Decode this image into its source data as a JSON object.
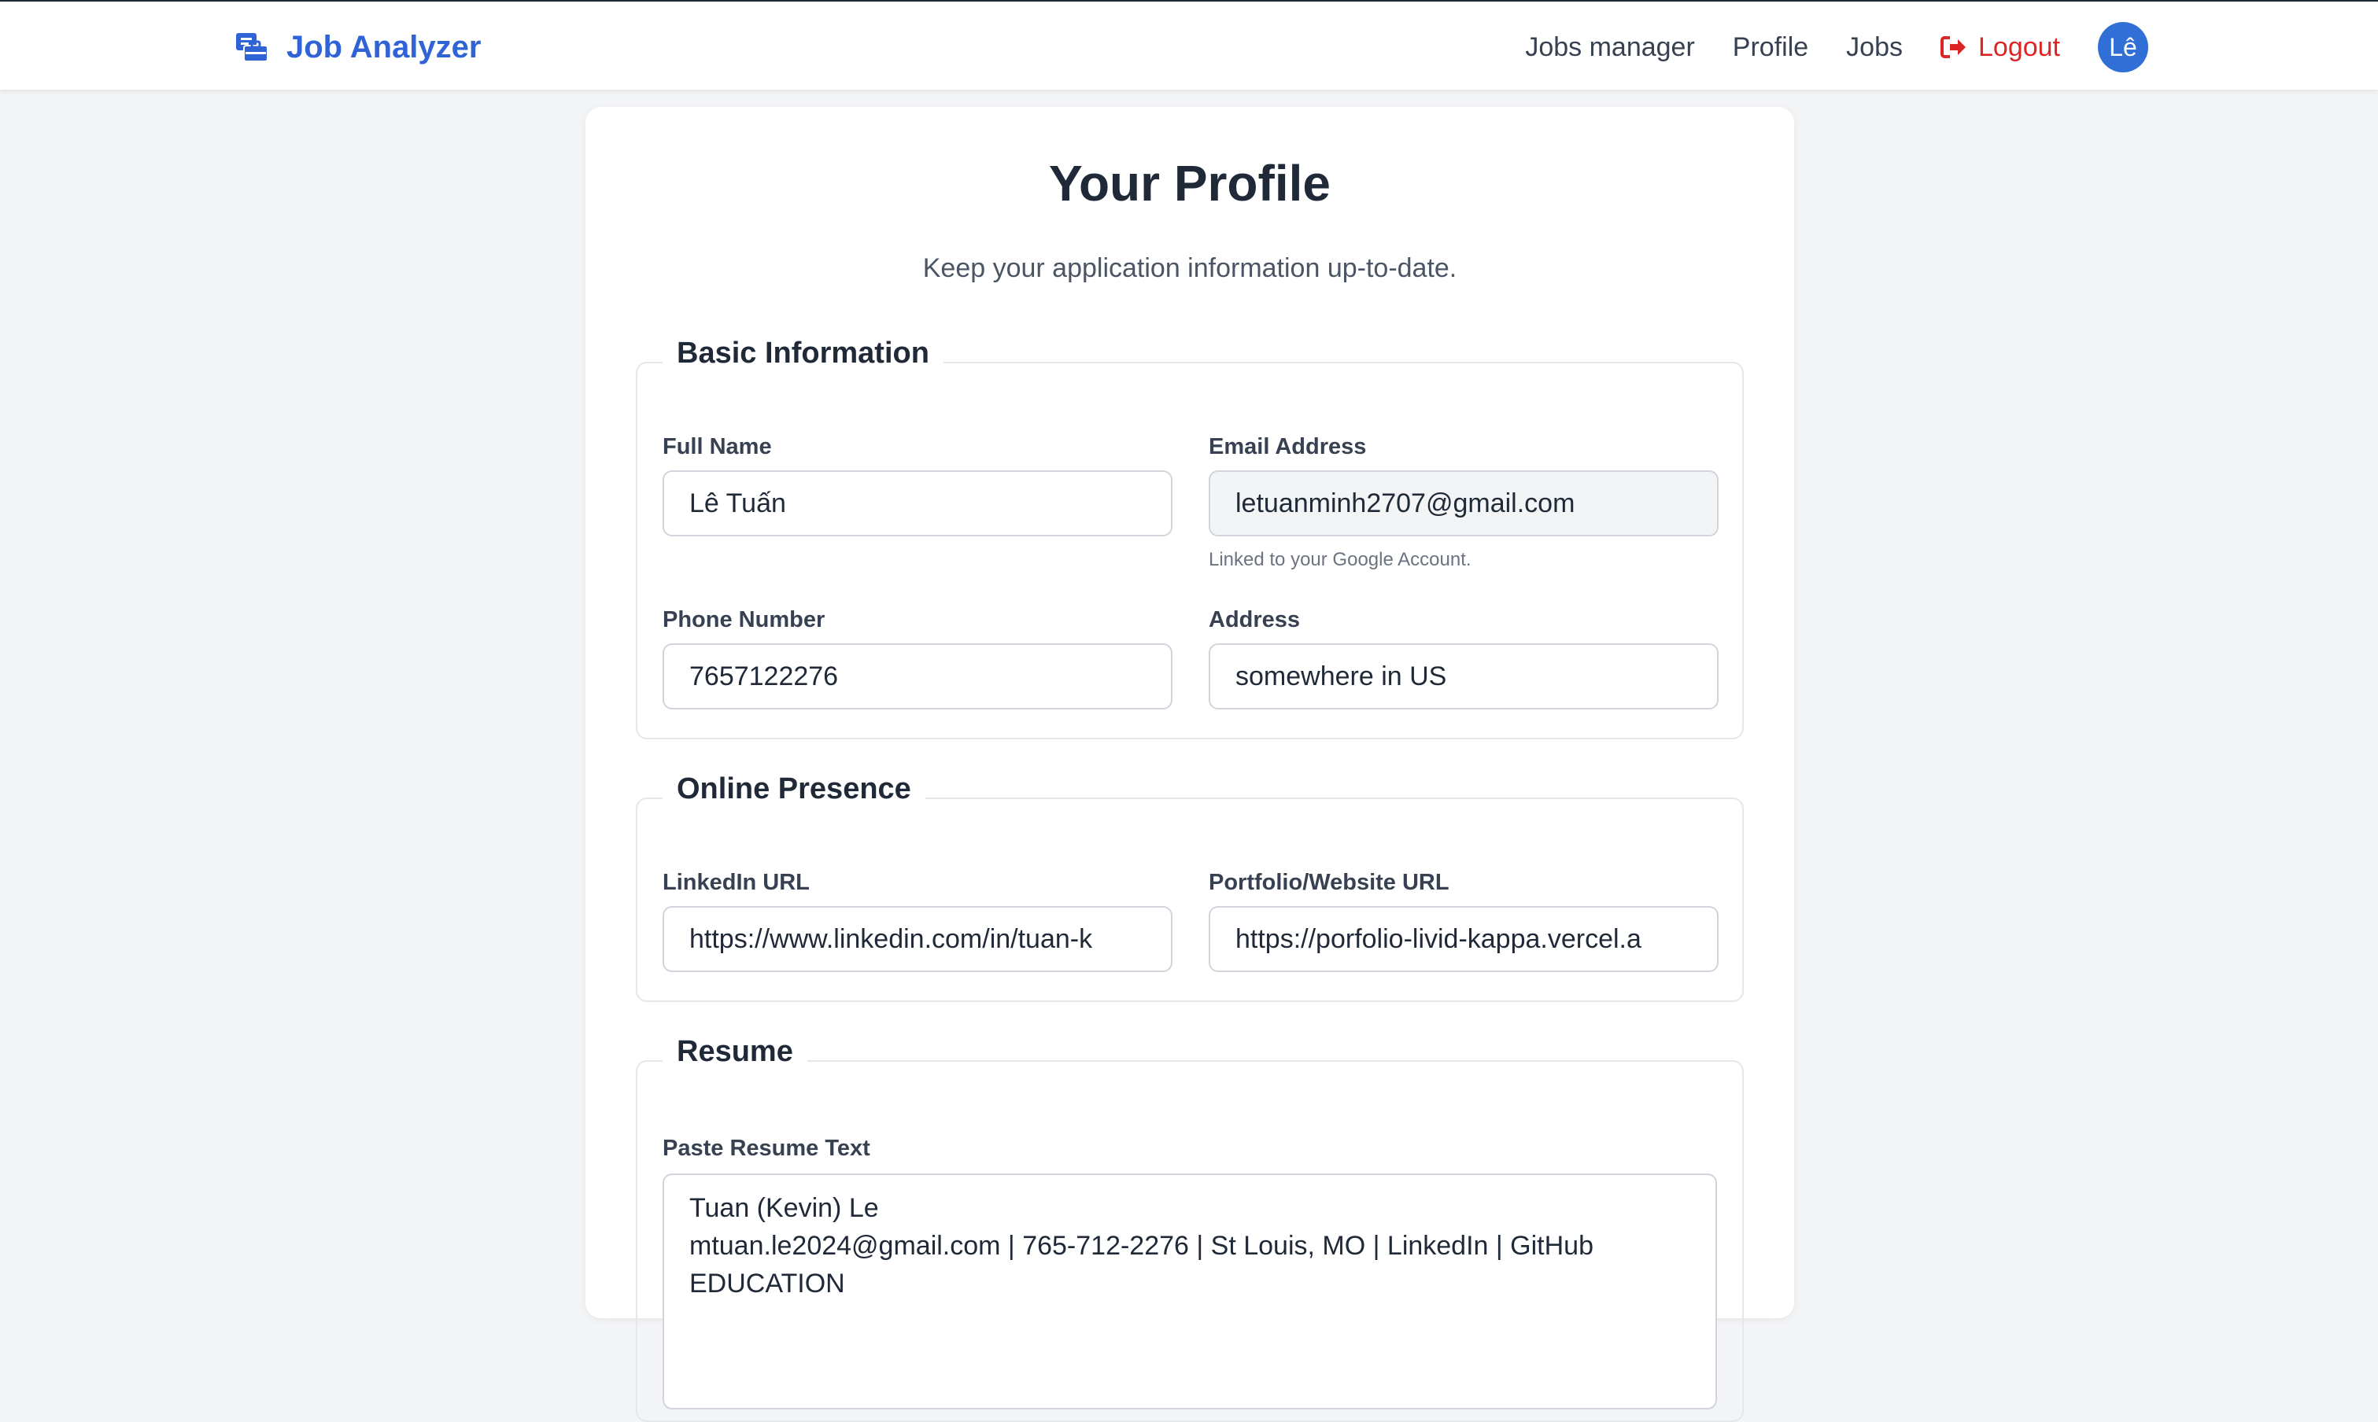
{
  "app": {
    "name": "Job Analyzer"
  },
  "nav": {
    "items": [
      "Jobs manager",
      "Profile",
      "Jobs"
    ],
    "logout": "Logout",
    "avatar": "Lê"
  },
  "page": {
    "title": "Your Profile",
    "subtitle": "Keep your application information up-to-date."
  },
  "basic": {
    "legend": "Basic Information",
    "full_name_label": "Full Name",
    "full_name": "Lê Tuấn",
    "email_label": "Email Address",
    "email": "letuanminh2707@gmail.com",
    "email_hint": "Linked to your Google Account.",
    "phone_label": "Phone Number",
    "phone": "7657122276",
    "address_label": "Address",
    "address": "somewhere in US"
  },
  "online": {
    "legend": "Online Presence",
    "linkedin_label": "LinkedIn URL",
    "linkedin": "https://www.linkedin.com/in/tuan-k",
    "portfolio_label": "Portfolio/Website URL",
    "portfolio": "https://porfolio-livid-kappa.vercel.a"
  },
  "resume": {
    "legend": "Resume",
    "text_label": "Paste Resume Text",
    "lines": [
      "Tuan (Kevin) Le",
      "mtuan.le2024@gmail.com | 765-712-2276 | St Louis, MO | LinkedIn | GitHub",
      "EDUCATION"
    ]
  },
  "colors": {
    "brand": "#2f63d6",
    "logout": "#dc2626",
    "avatar": "#2f6fd6"
  }
}
